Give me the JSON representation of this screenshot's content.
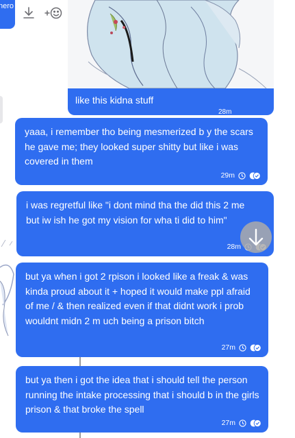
{
  "clipped_chip": {
    "label": "nero"
  },
  "toolbar": {
    "download_icon": "download-icon",
    "reaction_icon": "add-reaction-icon"
  },
  "messages": [
    {
      "text": "like this kidna stuff",
      "time": "28m",
      "type": "image"
    },
    {
      "text": "yaaa, i remember tho being mesmerized b y the scars he gave me; they looked super shitty but like i was covered in them",
      "time": "29m"
    },
    {
      "text": "i was regretful like \"i dont mind tha the did this 2 me but iw ish he got my vision for wha ti did to him\"",
      "time": "28m"
    },
    {
      "text": "but ya when i got 2 rpison i looked like a freak & was kinda proud about it + hoped it would make ppl afraid of me / & then realized even if that didnt work i prob wouldnt midn 2 m uch being a prison bitch",
      "time": "27m"
    },
    {
      "text": "but ya then i got the idea that i should tell the person running the intake processing that i should b in the girls prison & that broke the spell",
      "time": "27m"
    }
  ],
  "colors": {
    "bubble": "#2f6df0",
    "scroll_button": "#aaaaaa",
    "icon": "#6d6d72"
  }
}
